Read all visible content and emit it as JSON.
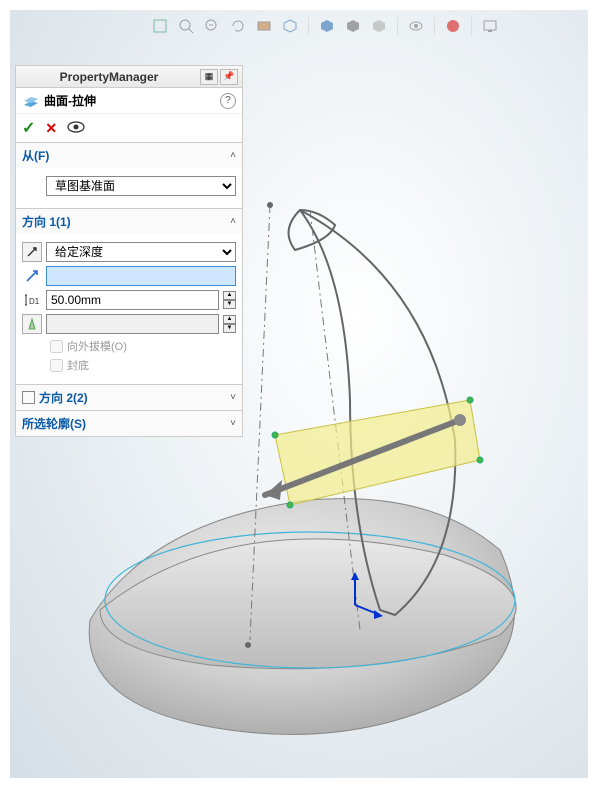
{
  "panel": {
    "title": "PropertyManager",
    "feature_name": "曲面-拉伸",
    "help": "?",
    "sections": {
      "from": {
        "label": "从(F)",
        "dropdown": "草图基准面"
      },
      "dir1": {
        "label": "方向 1(1)",
        "end_condition": "给定深度",
        "direction_value": "",
        "depth_value": "50.00mm",
        "draft_value": "",
        "draft_outward": "向外拔模(O)",
        "cap": "封底"
      },
      "dir2": {
        "label": "方向 2(2)"
      },
      "contours": {
        "label": "所选轮廓(S)"
      }
    }
  },
  "icons": {
    "ok": "✓",
    "cancel": "✕",
    "preview": "👁",
    "expand": "⌄",
    "collapse": "⌃",
    "reverse": "↗",
    "arrow": "↗",
    "depth": "D1"
  }
}
